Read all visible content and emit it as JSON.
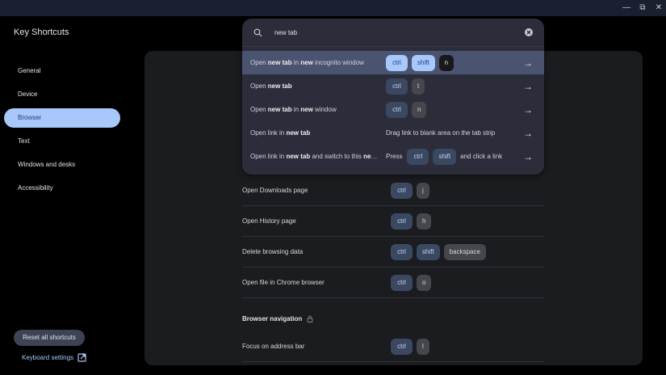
{
  "window": {
    "controls": [
      "minimize",
      "restore",
      "close"
    ]
  },
  "app": {
    "title": "Key Shortcuts"
  },
  "sidebar": {
    "items": [
      {
        "label": "General"
      },
      {
        "label": "Device"
      },
      {
        "label": "Browser",
        "active": true
      },
      {
        "label": "Text"
      },
      {
        "label": "Windows and desks"
      },
      {
        "label": "Accessibility"
      }
    ],
    "reset_label": "Reset all shortcuts",
    "keyboard_settings_label": "Keyboard settings"
  },
  "search": {
    "query": "new tab",
    "results": [
      {
        "desc": [
          [
            "Open ",
            false
          ],
          [
            "new tab",
            true
          ],
          [
            " in ",
            false
          ],
          [
            "new",
            true
          ],
          [
            " incognito window",
            false
          ]
        ],
        "keys": [
          [
            "k",
            "ctrl",
            true
          ],
          [
            "k",
            "shift",
            true
          ],
          [
            "k",
            "n",
            false
          ]
        ],
        "highlighted": true
      },
      {
        "desc": [
          [
            "Open ",
            false
          ],
          [
            "new tab",
            true
          ]
        ],
        "keys": [
          [
            "k",
            "ctrl",
            true
          ],
          [
            "k",
            "t",
            false
          ]
        ]
      },
      {
        "desc": [
          [
            "Open ",
            false
          ],
          [
            "new tab",
            true
          ],
          [
            " in ",
            false
          ],
          [
            "new",
            true
          ],
          [
            " window",
            false
          ]
        ],
        "keys": [
          [
            "k",
            "ctrl",
            true
          ],
          [
            "k",
            "n",
            false
          ]
        ]
      },
      {
        "desc": [
          [
            "Open link in ",
            false
          ],
          [
            "new tab",
            true
          ]
        ],
        "keys": [
          [
            "t",
            "Drag link to blank area on the tab strip"
          ]
        ]
      },
      {
        "desc": [
          [
            "Open link in ",
            false
          ],
          [
            "new tab",
            true
          ],
          [
            " and switch to this ",
            false
          ],
          [
            "new window",
            true
          ]
        ],
        "keys": [
          [
            "t",
            "Press"
          ],
          [
            "k",
            "ctrl",
            true
          ],
          [
            "k",
            "shift",
            true
          ],
          [
            "t",
            "and click a link"
          ]
        ]
      }
    ]
  },
  "main": {
    "rows": [
      {
        "desc": "Open Downloads page",
        "keys": [
          [
            "ctrl",
            true
          ],
          [
            "j",
            false
          ]
        ]
      },
      {
        "desc": "Open History page",
        "keys": [
          [
            "ctrl",
            true
          ],
          [
            "h",
            false
          ]
        ]
      },
      {
        "desc": "Delete browsing data",
        "keys": [
          [
            "ctrl",
            true
          ],
          [
            "shift",
            true
          ],
          [
            "backspace",
            false
          ]
        ]
      },
      {
        "desc": "Open file in Chrome browser",
        "keys": [
          [
            "ctrl",
            true
          ],
          [
            "o",
            false
          ]
        ]
      }
    ],
    "section": "Browser navigation",
    "section_rows": [
      {
        "desc": "Focus on address bar",
        "keys": [
          [
            "ctrl",
            true
          ],
          [
            "l",
            false
          ]
        ]
      }
    ]
  }
}
